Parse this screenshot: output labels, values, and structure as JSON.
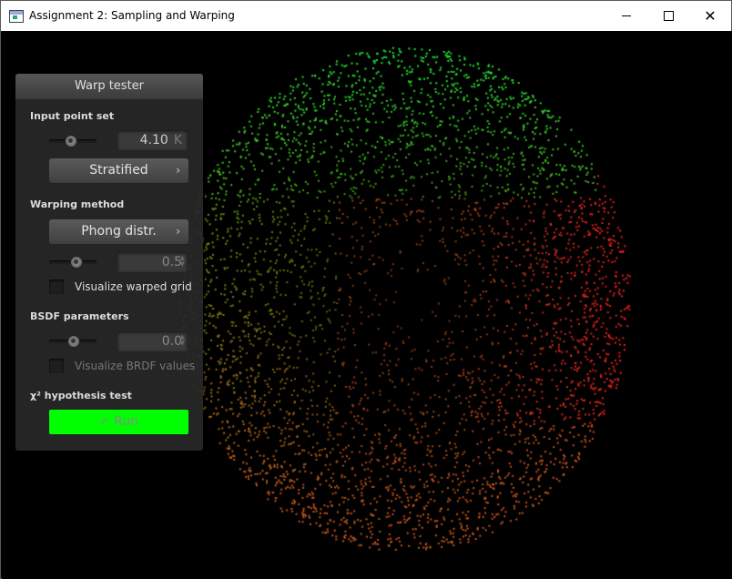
{
  "window": {
    "title": "Assignment 2: Sampling and Warping",
    "controls": {
      "minimize": "minimize-icon",
      "maximize": "maximize-icon",
      "close": "close-icon"
    }
  },
  "panel": {
    "title": "Warp tester",
    "input_point_set": {
      "label": "Input point set",
      "slider_level": 0.45,
      "count_value": "4.10",
      "count_unit": "K",
      "method_button": "Stratified"
    },
    "warping_method": {
      "label": "Warping method",
      "method_button": "Phong distr.",
      "slider_level": 0.55,
      "param_value": "0.5",
      "visualize_grid_label": "Visualize warped grid"
    },
    "bsdf": {
      "label": "BSDF parameters",
      "slider_level": 0.5,
      "param_value": "0.0",
      "visualize_brdf_label": "Visualize BRDF values"
    },
    "chi2": {
      "label": "χ² hypothesis test",
      "run_label": "✓ Run"
    }
  },
  "colors": {
    "green_region": "#2ed62e",
    "red_region": "#e81f1f",
    "orange_region": "#c4541c",
    "run_button": "#00ff00"
  }
}
